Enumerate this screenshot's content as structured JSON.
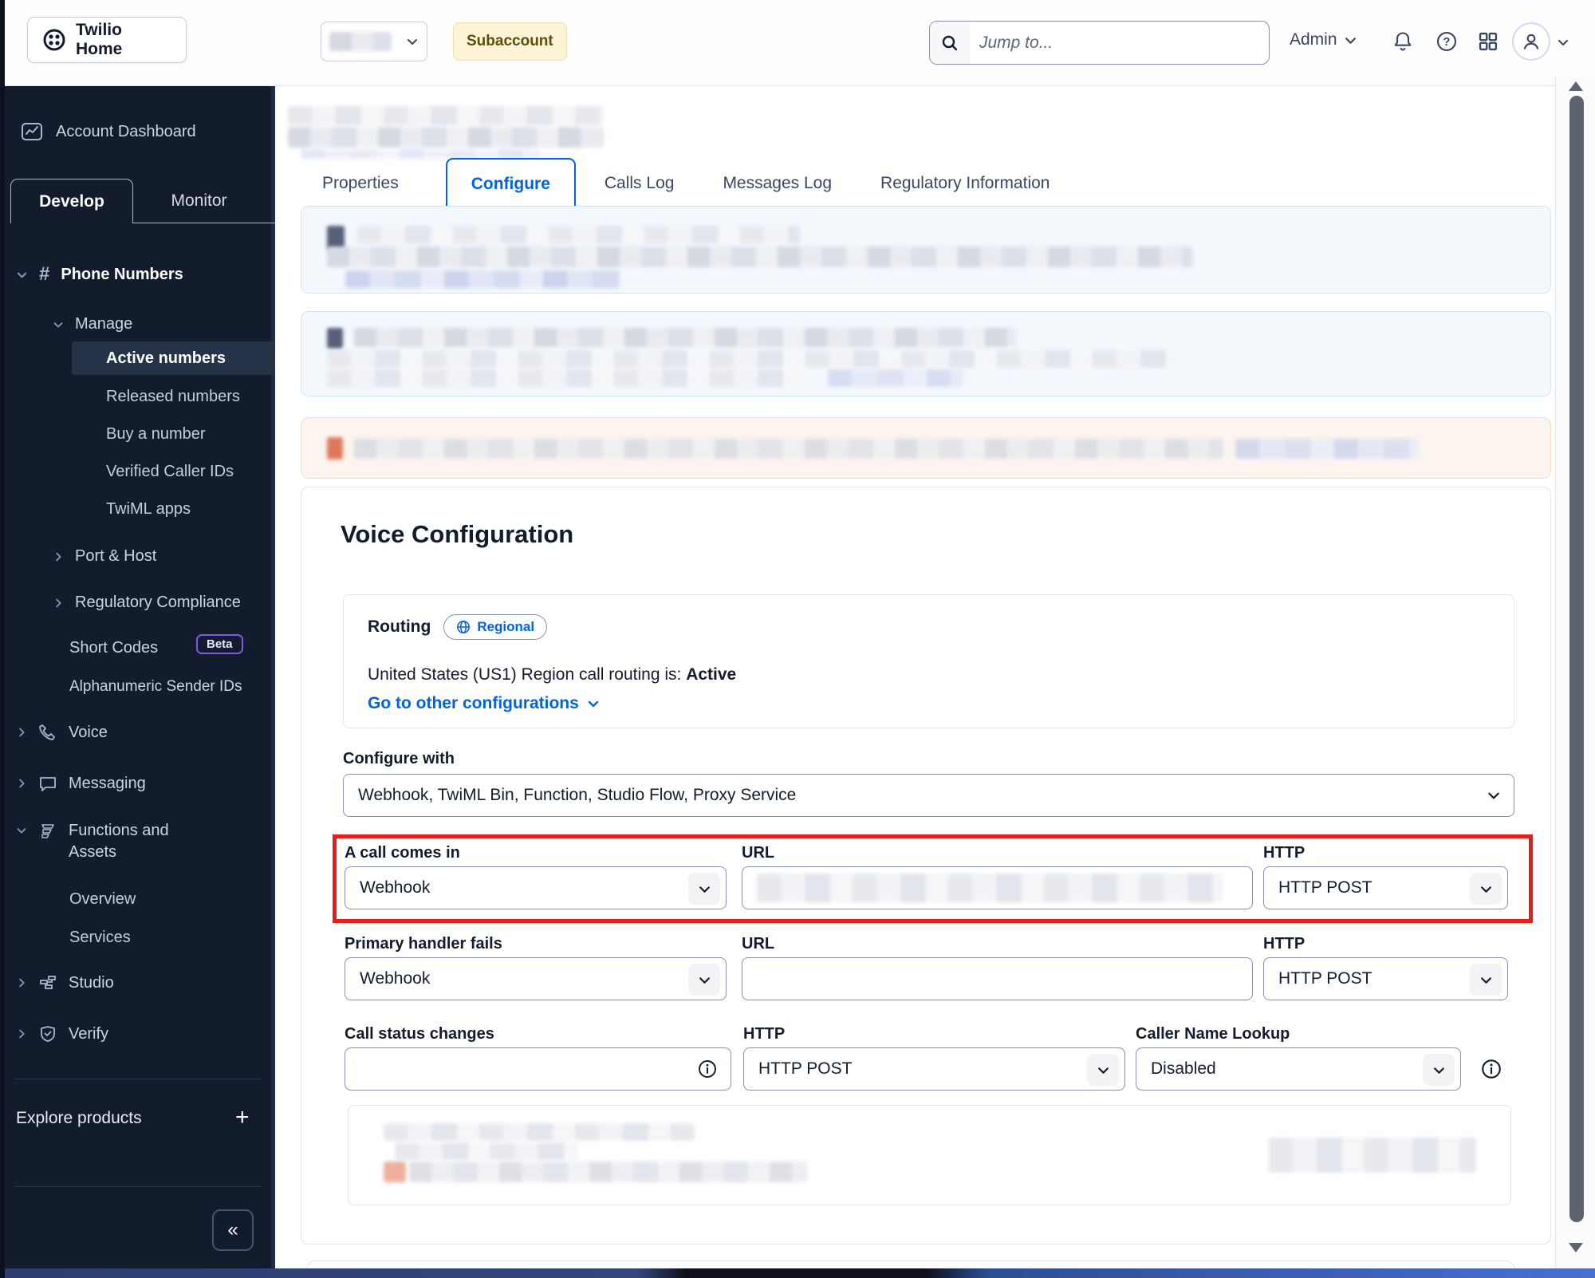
{
  "colors": {
    "accent_blue": "#0263e0",
    "annotation_red": "#e81c1c",
    "sidebar_bg": "#121c2d",
    "subaccount_bg": "#fdf3d7",
    "subaccount_text": "#5f4d0a"
  },
  "header": {
    "home_button": "Twilio Home",
    "subaccount_badge": "Subaccount",
    "search_placeholder": "Jump to...",
    "admin_label": "Admin"
  },
  "sidebar": {
    "dashboard": "Account Dashboard",
    "tabs": {
      "develop": "Develop",
      "monitor": "Monitor"
    },
    "hash_icon": "#",
    "phone_numbers": "Phone Numbers",
    "manage": "Manage",
    "manage_items": [
      "Active numbers",
      "Released numbers",
      "Buy a number",
      "Verified Caller IDs",
      "TwiML apps"
    ],
    "active_item": "Active numbers",
    "port_host": "Port & Host",
    "regulatory_compliance": "Regulatory Compliance",
    "short_codes": "Short Codes",
    "beta_badge": "Beta",
    "alphanumeric_sender_ids": "Alphanumeric Sender IDs",
    "voice": "Voice",
    "messaging": "Messaging",
    "functions_and_assets": "Functions and Assets",
    "functions_items": [
      "Overview",
      "Services"
    ],
    "studio": "Studio",
    "verify": "Verify",
    "explore_products": "Explore products",
    "plus_icon": "+",
    "collapse_icon": "«"
  },
  "page": {
    "tabs": [
      "Properties",
      "Configure",
      "Calls Log",
      "Messages Log",
      "Regulatory Information"
    ],
    "active_tab": "Configure"
  },
  "voice_config": {
    "title": "Voice Configuration",
    "routing": {
      "label": "Routing",
      "badge": "Regional",
      "status_text": "United States (US1) Region call routing is:",
      "status_value": "Active",
      "link": "Go to other configurations"
    },
    "configure_with": {
      "label": "Configure with",
      "value": "Webhook, TwiML Bin, Function, Studio Flow, Proxy Service"
    },
    "call_comes_in": {
      "label": "A call comes in",
      "value": "Webhook",
      "url_label": "URL",
      "http_label": "HTTP",
      "http_value": "HTTP POST"
    },
    "primary_handler_fails": {
      "label": "Primary handler fails",
      "value": "Webhook",
      "url_label": "URL",
      "url_value": "",
      "http_label": "HTTP",
      "http_value": "HTTP POST"
    },
    "call_status_changes": {
      "label": "Call status changes",
      "value": "",
      "http_label": "HTTP",
      "http_value": "HTTP POST"
    },
    "caller_name_lookup": {
      "label": "Caller Name Lookup",
      "value": "Disabled"
    }
  }
}
